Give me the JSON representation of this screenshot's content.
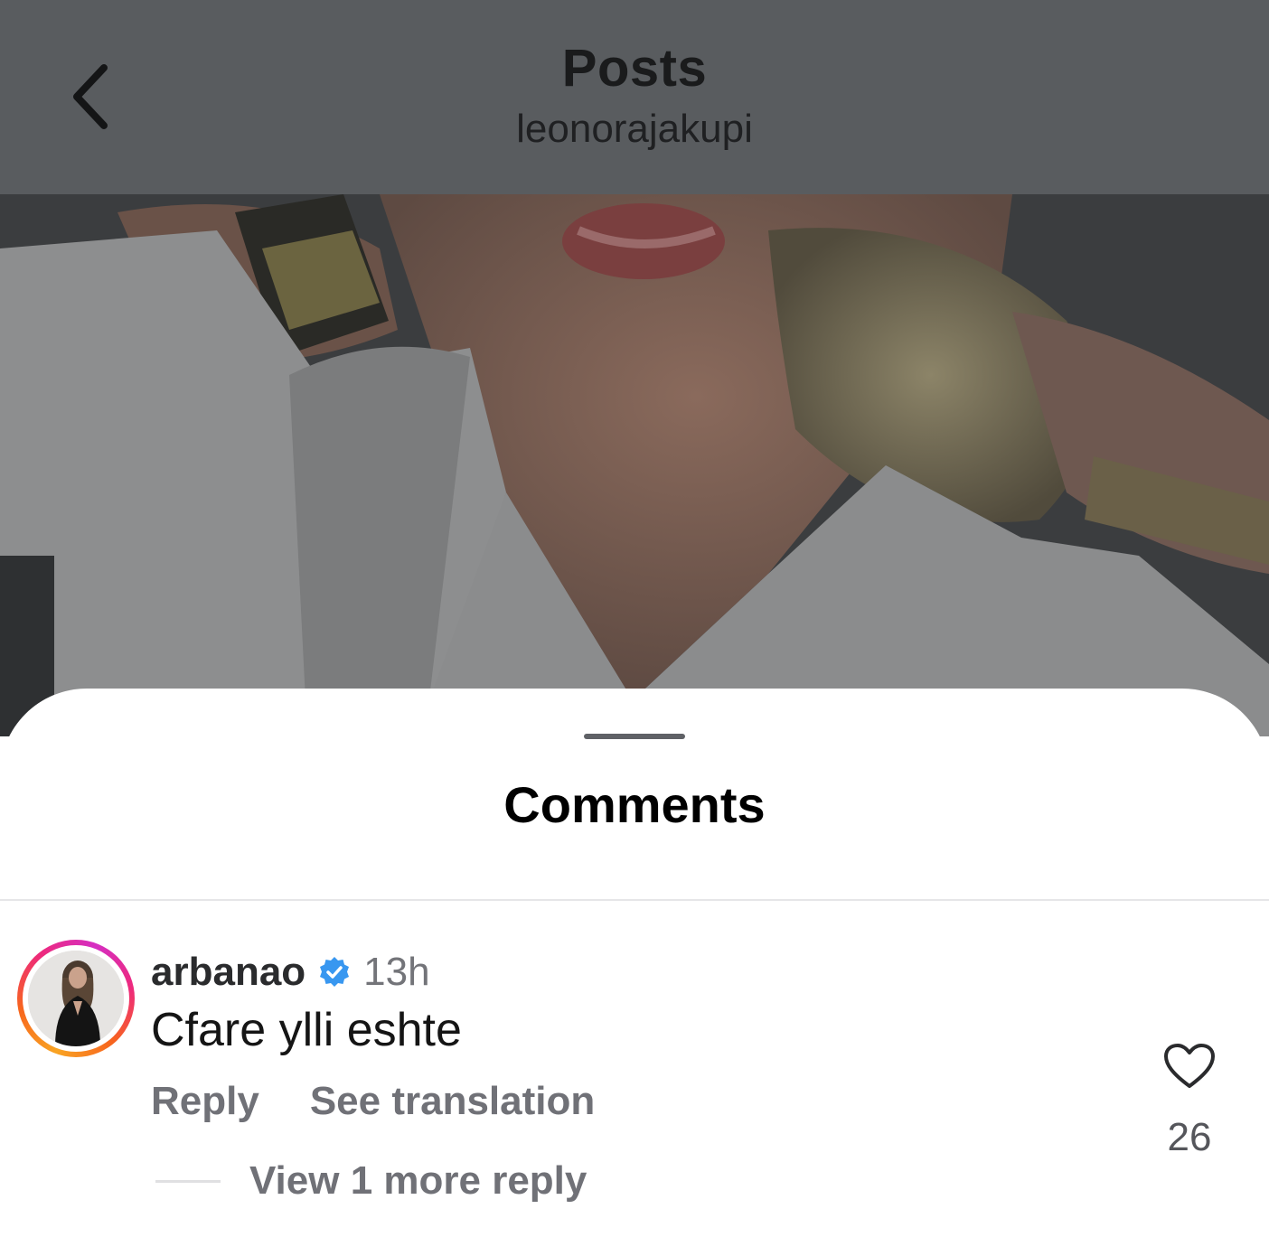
{
  "header": {
    "title": "Posts",
    "subtitle": "leonorajakupi"
  },
  "sheet": {
    "title": "Comments"
  },
  "comment": {
    "username": "arbanao",
    "verified": true,
    "time": "13h",
    "text": "Cfare ylli eshte",
    "reply_label": "Reply",
    "translate_label": "See translation",
    "like_count": "26",
    "view_more_replies": "View 1 more reply"
  },
  "colors": {
    "header_dim": "#595c5f",
    "verified_blue": "#3897f0",
    "ring_gradient": [
      "#f9a423",
      "#ee2a7b",
      "#d52ec2"
    ]
  },
  "icons": {
    "back": "chevron-left-icon",
    "verified": "verified-badge-icon",
    "like": "heart-outline-icon"
  }
}
